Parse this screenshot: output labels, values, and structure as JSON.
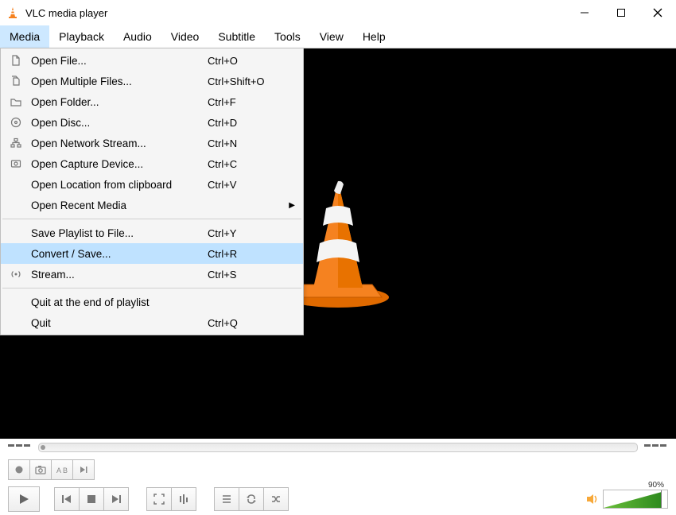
{
  "window": {
    "title": "VLC media player"
  },
  "menubar": [
    {
      "label": "Media",
      "active": true
    },
    {
      "label": "Playback",
      "active": false
    },
    {
      "label": "Audio",
      "active": false
    },
    {
      "label": "Video",
      "active": false
    },
    {
      "label": "Subtitle",
      "active": false
    },
    {
      "label": "Tools",
      "active": false
    },
    {
      "label": "View",
      "active": false
    },
    {
      "label": "Help",
      "active": false
    }
  ],
  "dropdown": {
    "items": [
      {
        "icon": "file-icon",
        "label": "Open File...",
        "shortcut": "Ctrl+O"
      },
      {
        "icon": "files-icon",
        "label": "Open Multiple Files...",
        "shortcut": "Ctrl+Shift+O"
      },
      {
        "icon": "folder-icon",
        "label": "Open Folder...",
        "shortcut": "Ctrl+F"
      },
      {
        "icon": "disc-icon",
        "label": "Open Disc...",
        "shortcut": "Ctrl+D"
      },
      {
        "icon": "network-icon",
        "label": "Open Network Stream...",
        "shortcut": "Ctrl+N"
      },
      {
        "icon": "capture-icon",
        "label": "Open Capture Device...",
        "shortcut": "Ctrl+C"
      },
      {
        "icon": "",
        "label": "Open Location from clipboard",
        "shortcut": "Ctrl+V"
      },
      {
        "icon": "",
        "label": "Open Recent Media",
        "shortcut": "",
        "submenu": true
      },
      {
        "sep": true
      },
      {
        "icon": "",
        "label": "Save Playlist to File...",
        "shortcut": "Ctrl+Y"
      },
      {
        "icon": "",
        "label": "Convert / Save...",
        "shortcut": "Ctrl+R",
        "highlight": true
      },
      {
        "icon": "stream-icon",
        "label": "Stream...",
        "shortcut": "Ctrl+S"
      },
      {
        "sep": true
      },
      {
        "icon": "",
        "label": "Quit at the end of playlist",
        "shortcut": ""
      },
      {
        "icon": "",
        "label": "Quit",
        "shortcut": "Ctrl+Q"
      }
    ]
  },
  "controls": {
    "volume_percent": "90%",
    "volume_ratio": 0.9
  }
}
